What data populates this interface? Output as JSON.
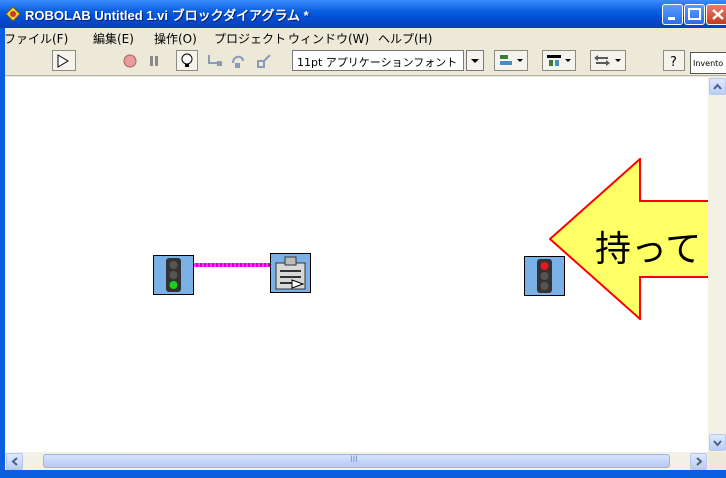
{
  "window": {
    "title": "ROBOLAB Untitled 1.vi ブロックダイアグラム *",
    "minimize_icon": "minimize-icon",
    "maximize_icon": "maximize-icon",
    "close_icon": "close-icon"
  },
  "menu": [
    {
      "label": "ファイル(F)"
    },
    {
      "label": "編集(E)"
    },
    {
      "label": "操作(O)"
    },
    {
      "label": "プロジェクト"
    },
    {
      "label": "ウィンドウ(W)"
    },
    {
      "label": "ヘルプ(H)"
    }
  ],
  "toolbar": {
    "font_combo": "11pt アプリケーションフォント",
    "inventor_field": "Invento"
  },
  "diagram": {
    "nodes": [
      {
        "kind": "traffic-light",
        "lit": "green"
      },
      {
        "kind": "command-block"
      },
      {
        "kind": "traffic-light",
        "lit": "red"
      }
    ]
  },
  "callout": {
    "text": "持って",
    "color": "#FFFF66",
    "border_color": "#FF0000"
  },
  "scrollbars": {
    "thumb_label": "III"
  }
}
